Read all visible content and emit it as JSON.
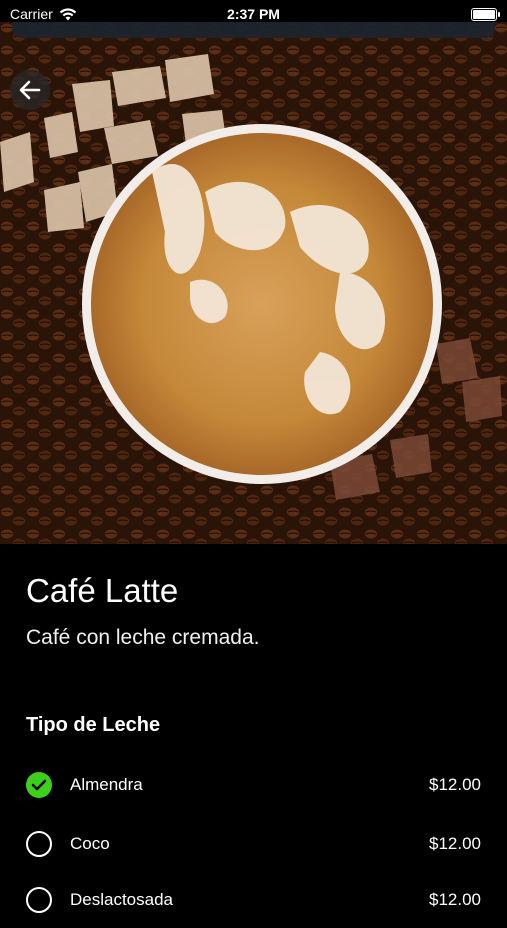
{
  "status_bar": {
    "carrier": "Carrier",
    "time": "2:37 PM"
  },
  "product": {
    "name": "Café Latte",
    "description": "Café con leche cremada."
  },
  "milk_section": {
    "title": "Tipo de Leche",
    "options": [
      {
        "label": "Almendra",
        "price": "$12.00",
        "selected": true
      },
      {
        "label": "Coco",
        "price": "$12.00",
        "selected": false
      },
      {
        "label": "Deslactosada",
        "price": "$12.00",
        "selected": false
      }
    ]
  },
  "colors": {
    "accent_check": "#3ccf1c",
    "background": "#000000",
    "text": "#ffffff"
  },
  "icons": {
    "back": "arrow-left-icon",
    "wifi": "wifi-icon",
    "battery": "battery-icon",
    "check": "checkmark-icon"
  }
}
